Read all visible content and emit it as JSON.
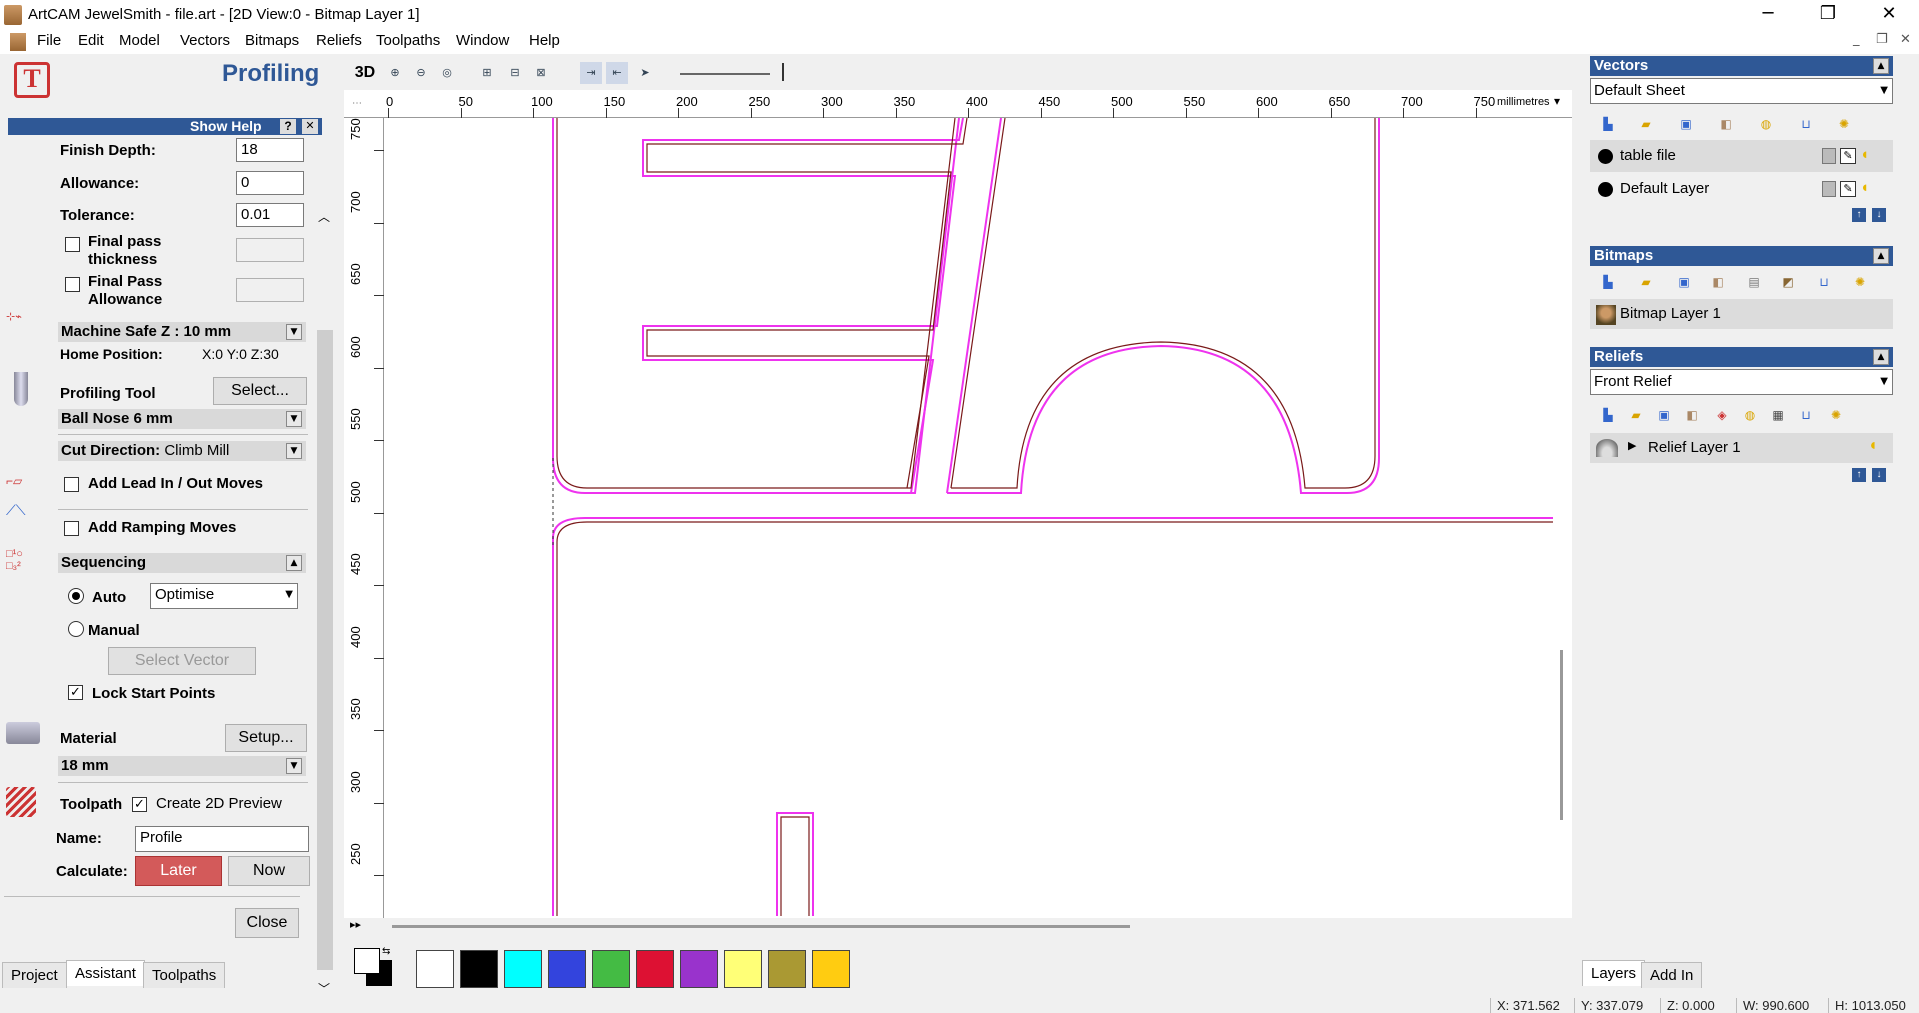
{
  "window": {
    "title": "ArtCAM JewelSmith - file.art - [2D View:0 - Bitmap Layer 1]"
  },
  "menu": [
    "File",
    "Edit",
    "Model",
    "Vectors",
    "Bitmaps",
    "Reliefs",
    "Toolpaths",
    "Window",
    "Help"
  ],
  "left": {
    "title": "Profiling",
    "show_help": "Show Help",
    "help_q": "?",
    "help_x": "✕",
    "finish_depth_label": "Finish Depth:",
    "finish_depth": "18",
    "allowance_label": "Allowance:",
    "allowance": "0",
    "tolerance_label": "Tolerance:",
    "tolerance": "0.01",
    "final_pass_thickness": "Final pass thickness",
    "final_pass_allowance": "Final Pass Allowance",
    "machine_safe_z": "Machine Safe Z : 10 mm",
    "home_position_label": "Home Position:",
    "home_position": "X:0 Y:0 Z:30",
    "profiling_tool_label": "Profiling Tool",
    "select_button": "Select...",
    "tool_name": "Ball Nose 6 mm",
    "cut_direction_label": "Cut Direction:",
    "cut_direction": "Climb Mill",
    "add_lead": "Add Lead In / Out Moves",
    "add_ramping": "Add Ramping Moves",
    "sequencing": "Sequencing",
    "auto_label": "Auto",
    "auto_option": "Optimise",
    "manual_label": "Manual",
    "select_vector": "Select Vector",
    "lock_start": "Lock Start Points",
    "material_label": "Material",
    "setup_button": "Setup...",
    "material_value": "18 mm",
    "toolpath_label": "Toolpath",
    "create_preview": "Create 2D Preview",
    "name_label": "Name:",
    "name_value": "Profile",
    "calculate_label": "Calculate:",
    "later": "Later",
    "now": "Now",
    "close": "Close"
  },
  "left_tabs": [
    "Project",
    "Assistant",
    "Toolpaths"
  ],
  "toolbar": {
    "3d": "3D"
  },
  "ruler": {
    "unit": "millimetres",
    "h_ticks": [
      "0",
      "50",
      "100",
      "150",
      "200",
      "250",
      "300",
      "350",
      "400",
      "450",
      "500",
      "550",
      "600",
      "650",
      "700",
      "750"
    ],
    "v_ticks": [
      "750",
      "700",
      "650",
      "600",
      "550",
      "500",
      "450",
      "400",
      "350",
      "300",
      "250"
    ]
  },
  "right": {
    "vectors_title": "Vectors",
    "vectors_sheet": "Default Sheet",
    "vector_layers": [
      "table file",
      "Default Layer"
    ],
    "bitmaps_title": "Bitmaps",
    "bitmap_layer": "Bitmap Layer 1",
    "reliefs_title": "Reliefs",
    "relief_combo": "Front Relief",
    "relief_layer": "Relief Layer 1"
  },
  "right_tabs": [
    "Layers",
    "Add In"
  ],
  "status": {
    "x": "X: 371.562",
    "y": "Y: 337.079",
    "z": "Z: 0.000",
    "w": "W: 990.600",
    "h": "H: 1013.050"
  },
  "colors": [
    "#ffffff",
    "#000000",
    "#00ffff",
    "#3344dd",
    "#44bb44",
    "#dd1133",
    "#9933cc",
    "#ffff77",
    "#aa9933",
    "#ffcc11"
  ]
}
